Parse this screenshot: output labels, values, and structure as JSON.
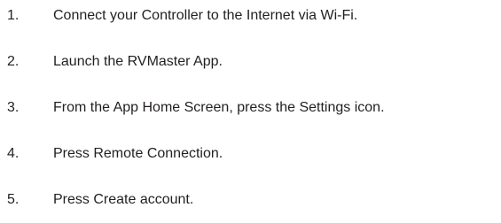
{
  "steps": [
    {
      "number": "1.",
      "text": "Connect your Controller to the Internet via Wi-Fi."
    },
    {
      "number": "2.",
      "text": "Launch the RVMaster App."
    },
    {
      "number": "3.",
      "text": "From the App Home Screen, press the Settings icon."
    },
    {
      "number": "4.",
      "text": "Press Remote Connection."
    },
    {
      "number": "5.",
      "text": "Press Create account."
    }
  ]
}
